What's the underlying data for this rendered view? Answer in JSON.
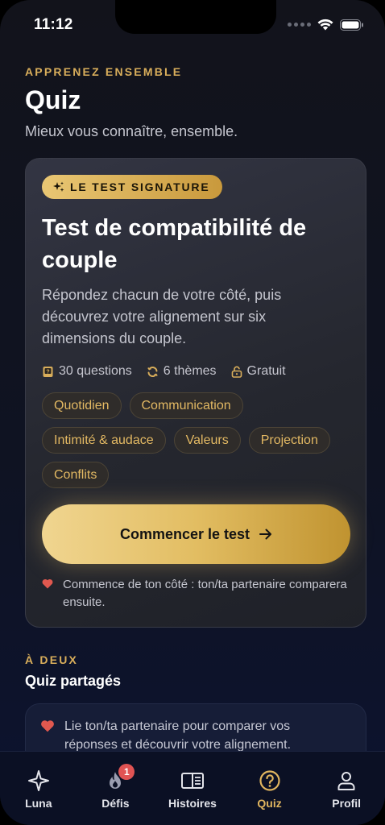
{
  "status": {
    "time": "11:12"
  },
  "header": {
    "eyebrow": "APPRENEZ ENSEMBLE",
    "title": "Quiz",
    "subtitle": "Mieux vous connaître, ensemble."
  },
  "signature_card": {
    "badge": "LE TEST SIGNATURE",
    "title": "Test de compatibilité de couple",
    "description": "Répondez chacun de votre côté, puis découvrez votre alignement sur six dimensions du couple.",
    "meta": {
      "questions": "30 questions",
      "themes": "6 thèmes",
      "price": "Gratuit"
    },
    "chips": [
      "Quotidien",
      "Communication",
      "Intimité & audace",
      "Valeurs",
      "Projection",
      "Conflits"
    ],
    "cta_label": "Commencer le test",
    "note": "Commence de ton côté : ton/ta partenaire comparera ensuite."
  },
  "shared_section": {
    "eyebrow": "À DEUX",
    "title": "Quiz partagés",
    "info": "Lie ton/ta partenaire pour comparer vos réponses et découvrir votre alignement."
  },
  "tabbar": {
    "items": [
      {
        "label": "Luna",
        "icon": "sparkle-icon"
      },
      {
        "label": "Défis",
        "icon": "flame-icon",
        "badge": "1"
      },
      {
        "label": "Histoires",
        "icon": "book-icon"
      },
      {
        "label": "Quiz",
        "icon": "question-icon",
        "active": true
      },
      {
        "label": "Profil",
        "icon": "person-icon"
      }
    ]
  },
  "colors": {
    "accent_gold": "#e0b55f",
    "badge_red": "#e05353",
    "heart_red": "#e0584f"
  }
}
